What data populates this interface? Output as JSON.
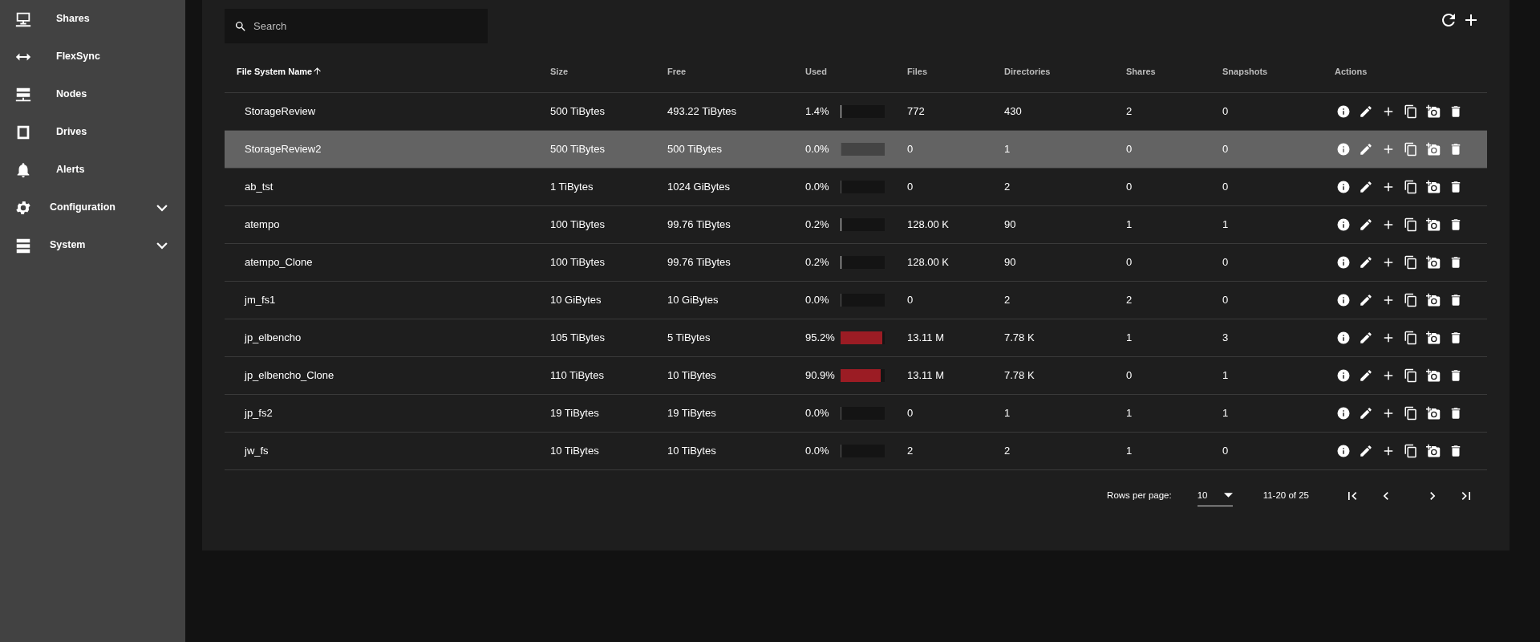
{
  "sidebar": {
    "items": [
      {
        "label": "Shares",
        "kind": "link"
      },
      {
        "label": "FlexSync",
        "kind": "link"
      },
      {
        "label": "Nodes",
        "kind": "link"
      },
      {
        "label": "Drives",
        "kind": "link"
      },
      {
        "label": "Alerts",
        "kind": "link"
      },
      {
        "label": "Configuration",
        "kind": "group",
        "expanded": false
      },
      {
        "label": "System",
        "kind": "group",
        "expanded": false
      }
    ]
  },
  "search": {
    "placeholder": "Search"
  },
  "table": {
    "columns": [
      {
        "label": "File System Name",
        "sorted": true
      },
      {
        "label": "Size",
        "sorted": false
      },
      {
        "label": "Free",
        "sorted": false
      },
      {
        "label": "Used",
        "sorted": false
      },
      {
        "label": "Files",
        "sorted": false
      },
      {
        "label": "Directories",
        "sorted": false
      },
      {
        "label": "Shares",
        "sorted": false
      },
      {
        "label": "Snapshots",
        "sorted": false
      },
      {
        "label": "Actions",
        "sorted": false
      }
    ],
    "rows": [
      {
        "name": "StorageReview",
        "size": "500 TiBytes",
        "free": "493.22 TiBytes",
        "used": "1.4%",
        "level": 0.014,
        "files": "772",
        "directories": "430",
        "shares": "2",
        "snapshots": "0",
        "selected": false
      },
      {
        "name": "StorageReview2",
        "size": "500 TiBytes",
        "free": "500 TiBytes",
        "used": "0.0%",
        "level": 0,
        "files": "0",
        "directories": "1",
        "shares": "0",
        "snapshots": "0",
        "selected": true
      },
      {
        "name": "ab_tst",
        "size": "1 TiBytes",
        "free": "1024 GiBytes",
        "used": "0.0%",
        "level": 0,
        "files": "0",
        "directories": "2",
        "shares": "0",
        "snapshots": "0",
        "selected": false
      },
      {
        "name": "atempo",
        "size": "100 TiBytes",
        "free": "99.76 TiBytes",
        "used": "0.2%",
        "level": 0.002,
        "files": "128.00 K",
        "directories": "90",
        "shares": "1",
        "snapshots": "1",
        "selected": false
      },
      {
        "name": "atempo_Clone",
        "size": "100 TiBytes",
        "free": "99.76 TiBytes",
        "used": "0.2%",
        "level": 0.002,
        "files": "128.00 K",
        "directories": "90",
        "shares": "0",
        "snapshots": "0",
        "selected": false
      },
      {
        "name": "jm_fs1",
        "size": "10 GiBytes",
        "free": "10 GiBytes",
        "used": "0.0%",
        "level": 0,
        "files": "0",
        "directories": "2",
        "shares": "2",
        "snapshots": "0",
        "selected": false
      },
      {
        "name": "jp_elbencho",
        "size": "105 TiBytes",
        "free": "5 TiBytes",
        "used": "95.2%",
        "level": 0.952,
        "files": "13.11 M",
        "directories": "7.78 K",
        "shares": "1",
        "snapshots": "3",
        "selected": false
      },
      {
        "name": "jp_elbencho_Clone",
        "size": "110 TiBytes",
        "free": "10 TiBytes",
        "used": "90.9%",
        "level": 0.909,
        "files": "13.11 M",
        "directories": "7.78 K",
        "shares": "0",
        "snapshots": "1",
        "selected": false
      },
      {
        "name": "jp_fs2",
        "size": "19 TiBytes",
        "free": "19 TiBytes",
        "used": "0.0%",
        "level": 0,
        "files": "0",
        "directories": "1",
        "shares": "1",
        "snapshots": "1",
        "selected": false
      },
      {
        "name": "jw_fs",
        "size": "10 TiBytes",
        "free": "10 TiBytes",
        "used": "0.0%",
        "level": 0,
        "files": "2",
        "directories": "2",
        "shares": "1",
        "snapshots": "0",
        "selected": false
      }
    ]
  },
  "pagination": {
    "rows_per_page_label": "Rows per page:",
    "rows_per_page": "10",
    "range": "11-20 of 25"
  }
}
